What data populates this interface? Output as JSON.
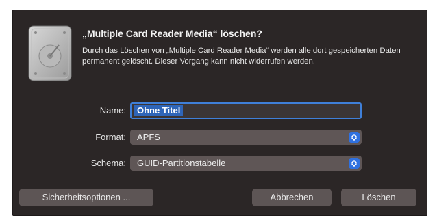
{
  "dialog": {
    "title": "„Multiple Card Reader Media“ löschen?",
    "message": "Durch das Löschen von „Multiple Card Reader Media“ werden alle dort gespeicherten Daten permanent gelöscht. Dieser Vorgang kann nicht widerrufen werden.",
    "icon": "hard-disk-icon"
  },
  "form": {
    "name_label": "Name:",
    "name_value": "Ohne Titel",
    "format_label": "Format:",
    "format_value": "APFS",
    "scheme_label": "Schema:",
    "scheme_value": "GUID-Partitionstabelle"
  },
  "buttons": {
    "security": "Sicherheitsoptionen ...",
    "cancel": "Abbrechen",
    "erase": "Löschen"
  },
  "colors": {
    "dialog_bg": "#2b2626",
    "focus_ring": "#3f7fd8",
    "accent": "#2f71e0",
    "button_bg": "#5d5555"
  }
}
